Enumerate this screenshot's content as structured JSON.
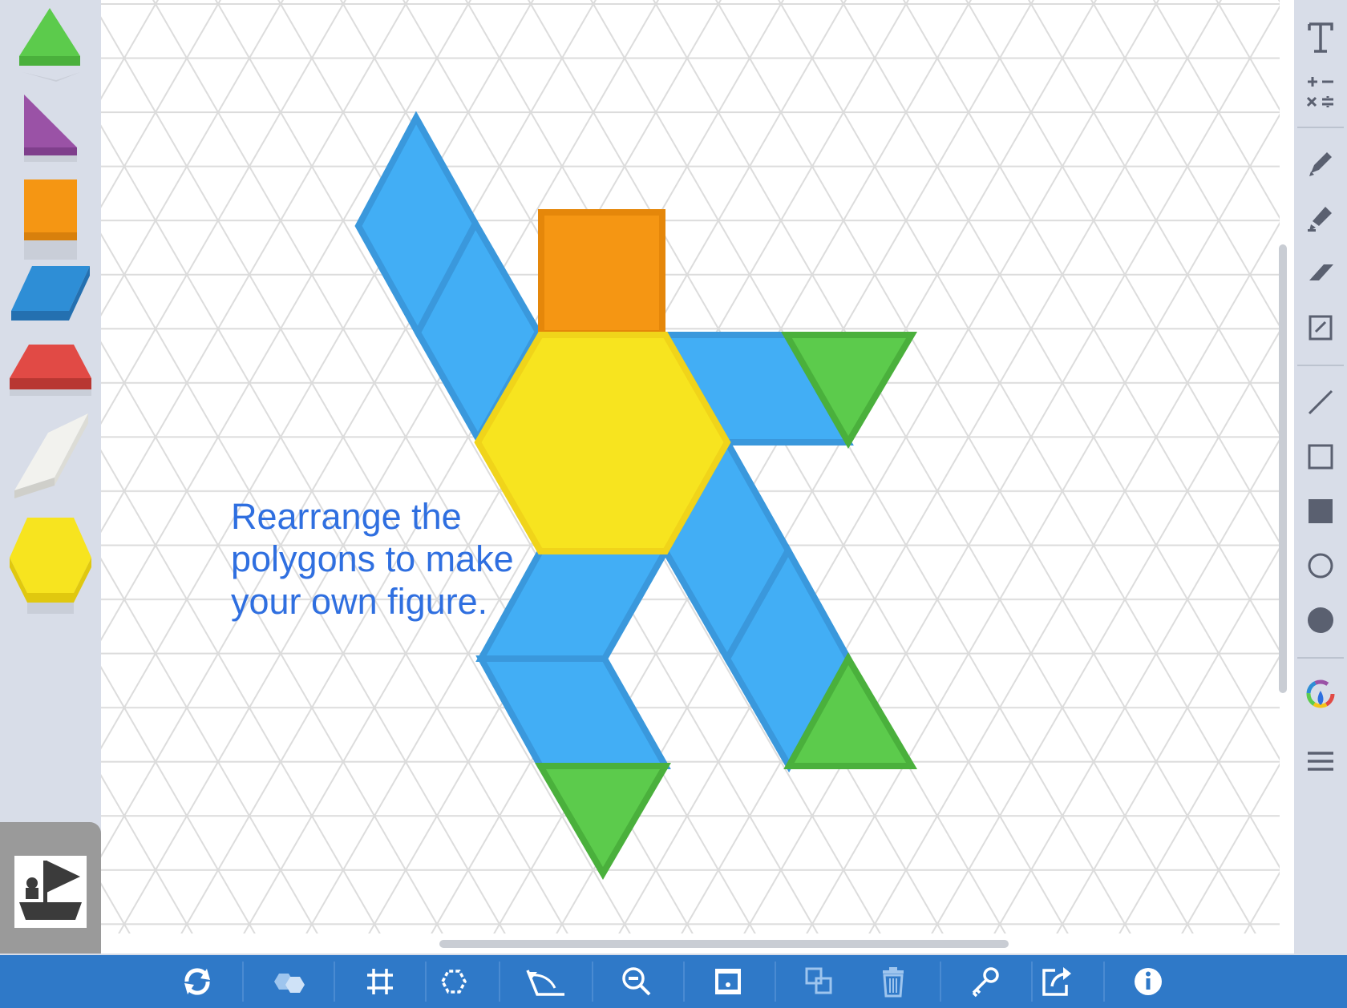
{
  "instruction_text": "Rearrange the polygons to make your own figure.",
  "colors": {
    "triangle_green": "#5ccb4c",
    "triangle_green_dark": "#4ab03c",
    "rhombus_blue": "#42aef5",
    "rhombus_blue_dark": "#3a98dc",
    "square_orange": "#f59613",
    "square_orange_dark": "#e5870a",
    "hexagon_yellow": "#f7e41f",
    "hexagon_yellow_dark": "#f0d41a",
    "text_blue": "#2f6fe0",
    "grid_line": "#dcdcdc",
    "toolbar_blue": "#2f79c8",
    "icon_gray": "#5a6070"
  },
  "palette": [
    {
      "name": "triangle",
      "color": "#5ccb4c"
    },
    {
      "name": "right-triangle",
      "color": "#9a52a6"
    },
    {
      "name": "square",
      "color": "#f59613"
    },
    {
      "name": "parallelogram",
      "color": "#2e8ed6"
    },
    {
      "name": "trapezoid",
      "color": "#e14a45"
    },
    {
      "name": "thin-rhombus",
      "color": "#f2f2ee"
    },
    {
      "name": "hexagon",
      "color": "#f7e41f"
    }
  ],
  "right_toolbar": [
    {
      "icon": "text-icon"
    },
    {
      "icon": "math-operations-icon"
    },
    {
      "icon": "pencil-icon"
    },
    {
      "icon": "marker-icon"
    },
    {
      "icon": "eraser-icon"
    },
    {
      "icon": "note-edit-icon"
    },
    {
      "icon": "line-icon"
    },
    {
      "icon": "rectangle-outline-icon"
    },
    {
      "icon": "rectangle-filled-icon"
    },
    {
      "icon": "circle-outline-icon"
    },
    {
      "icon": "circle-filled-icon"
    },
    {
      "icon": "color-picker-icon"
    },
    {
      "icon": "menu-icon"
    }
  ],
  "bottom_toolbar": [
    {
      "icon": "rotate-icon"
    },
    {
      "icon": "shapes-icon"
    },
    {
      "icon": "grid-icon"
    },
    {
      "icon": "select-shape-icon"
    },
    {
      "icon": "angle-icon"
    },
    {
      "icon": "zoom-out-icon"
    },
    {
      "icon": "background-icon"
    },
    {
      "icon": "duplicate-icon"
    },
    {
      "icon": "trash-icon"
    },
    {
      "icon": "key-icon"
    },
    {
      "icon": "share-icon"
    },
    {
      "icon": "info-icon"
    }
  ]
}
